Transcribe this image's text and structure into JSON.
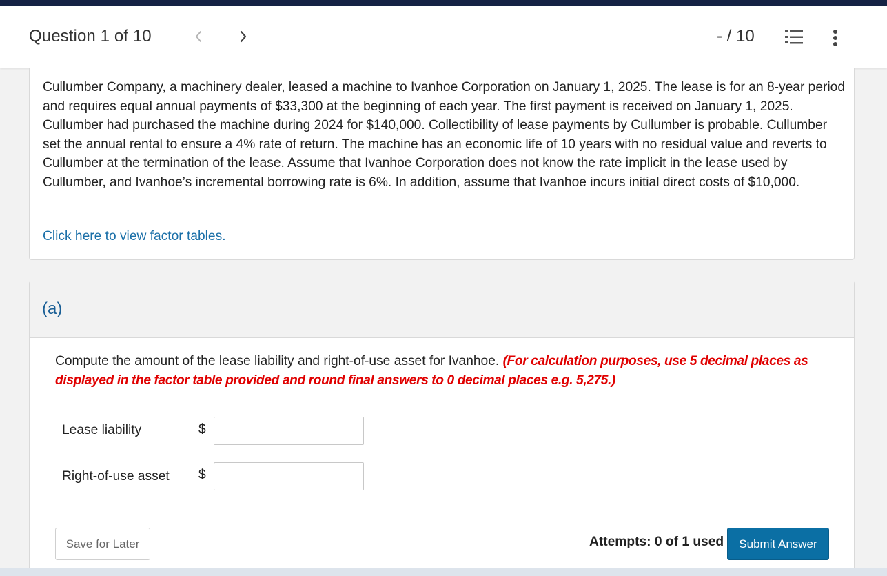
{
  "header": {
    "question_label": "Question 1 of 10",
    "score": "- / 10",
    "icons": {
      "prev": "chevron-left-icon",
      "next": "chevron-right-icon",
      "list": "numbered-list-icon",
      "more": "more-vertical-icon"
    }
  },
  "problem": {
    "text": "Cullumber Company, a machinery dealer, leased a machine to Ivanhoe Corporation on January 1, 2025. The lease is for an 8-year period and requires equal annual payments of $33,300 at the beginning of each year. The first payment is received on January 1, 2025. Cullumber had purchased the machine during 2024 for $140,000. Collectibility of lease payments by Cullumber is probable. Cullumber set the annual rental to ensure a 4% rate of return. The machine has an economic life of 10 years with no residual value and reverts to Cullumber at the termination of the lease. Assume that Ivanhoe Corporation does not know the rate implicit in the lease used by Cullumber, and Ivanhoe’s incremental borrowing rate is 6%. In addition, assume that Ivanhoe incurs initial direct costs of $10,000.",
    "factor_link": "Click here to view factor tables."
  },
  "part": {
    "label": "(a)",
    "instruction": "Compute the amount of the lease liability and right-of-use asset for Ivanhoe.",
    "instruction_note": "(For calculation purposes, use 5 decimal places as displayed in the factor table provided and round final answers to 0 decimal places e.g. 5,275.)",
    "fields": [
      {
        "label": "Lease liability",
        "currency": "$",
        "value": ""
      },
      {
        "label": "Right-of-use asset",
        "currency": "$",
        "value": ""
      }
    ],
    "save_label": "Save for Later",
    "attempts": "Attempts: 0 of 1 used",
    "submit_label": "Submit Answer"
  },
  "colors": {
    "top_bar": "#152244",
    "link": "#1a6fa8",
    "part_label": "#1a5f96",
    "note_red": "#e00000",
    "submit_bg": "#0b6fa4"
  }
}
